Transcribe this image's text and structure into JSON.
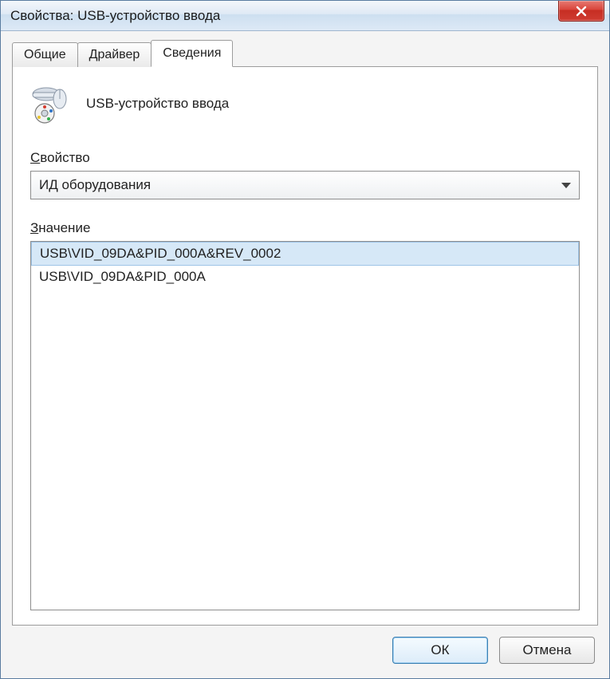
{
  "titlebar": {
    "title": "Свойства: USB-устройство ввода"
  },
  "tabs": [
    {
      "label": "Общие"
    },
    {
      "label": "Драйвер"
    },
    {
      "label": "Сведения"
    }
  ],
  "device": {
    "name": "USB-устройство ввода"
  },
  "propertyLabel": "Свойство",
  "propertyCombo": {
    "selected": "ИД оборудования"
  },
  "valueLabel": "Значение",
  "values": [
    "USB\\VID_09DA&PID_000A&REV_0002",
    "USB\\VID_09DA&PID_000A"
  ],
  "buttons": {
    "ok": "ОК",
    "cancel": "Отмена"
  }
}
